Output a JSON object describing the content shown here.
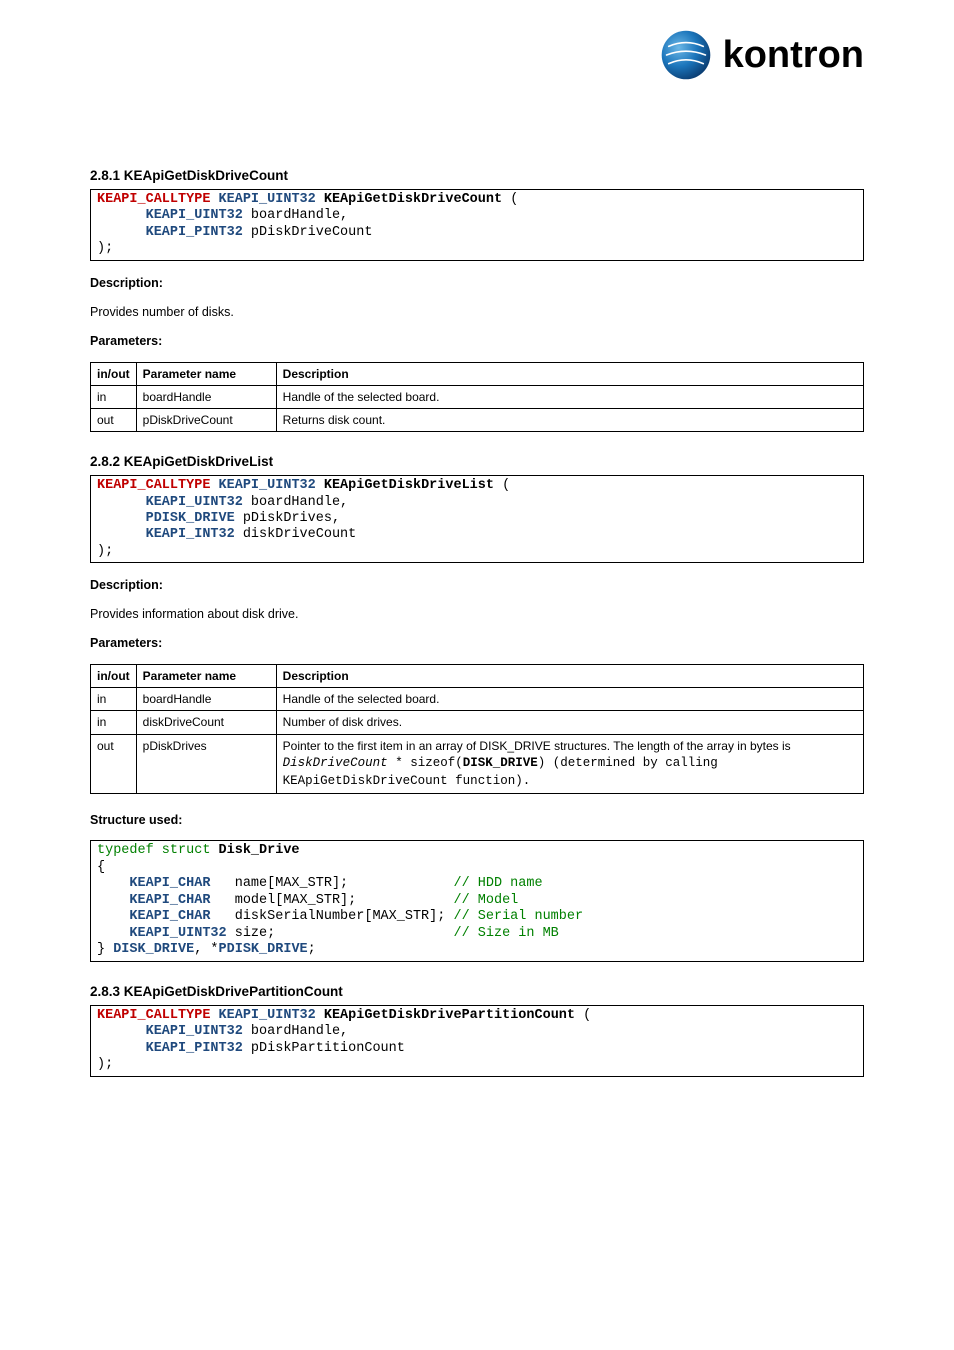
{
  "logo": {
    "brand": "kontron"
  },
  "fn1": {
    "heading": "2.8.1 KEApiGetDiskDriveCount",
    "sig": {
      "pre": "KEAPI_CALLTYPE",
      "ret": "KEAPI_UINT32",
      "name": "KEApiGetDiskDriveCount",
      "open": " (",
      "p1t": "KEAPI_UINT32",
      "p1n": " boardHandle,",
      "p2t": "KEAPI_PINT32",
      "p2n": " pDiskDriveCount",
      "close": ");"
    },
    "desc_label": "Description:",
    "desc": "Provides number of disks.",
    "params_label": "Parameters:",
    "th": {
      "a": "in/out",
      "b": "Parameter name",
      "c": "Description"
    },
    "rows": [
      {
        "a": "in",
        "b": "boardHandle",
        "c": "Handle of the selected board."
      },
      {
        "a": "out",
        "b": "pDiskDriveCount",
        "c": "Returns disk count."
      }
    ]
  },
  "fn2": {
    "heading": "2.8.2 KEApiGetDiskDriveList",
    "sig": {
      "pre": "KEAPI_CALLTYPE",
      "ret": "KEAPI_UINT32",
      "name": "KEApiGetDiskDriveList",
      "open": " (",
      "p1t": "KEAPI_UINT32",
      "p1n": " boardHandle,",
      "p2t": "PDISK_DRIVE",
      "p2n": " pDiskDrives,",
      "p3t": "KEAPI_INT32",
      "p3n": " diskDriveCount",
      "close": ");"
    },
    "desc_label": "Description:",
    "desc": "Provides information about disk drive.",
    "params_label": "Parameters:",
    "th": {
      "a": "in/out",
      "b": "Parameter name",
      "c": "Description"
    },
    "rows": [
      {
        "a": "in",
        "b": "boardHandle",
        "c": "Handle of the selected board."
      },
      {
        "a": "in",
        "b": "diskDriveCount",
        "c": "Number of disk drives."
      },
      {
        "a": "out",
        "b": "pDiskDrives",
        "c1": "Pointer to the first item in an array of DISK_DRIVE structures. The length of the array in bytes is ",
        "c_ital": "DiskDriveCount",
        "c2": " * sizeof(",
        "c_bold": "DISK_DRIVE",
        "c3": ") (determined by calling KEApiGetDiskDriveCount function)."
      }
    ],
    "struct_label": "Structure used:",
    "struct": {
      "l1a": "typedef struct",
      "l1b": " Disk_Drive",
      "l2": "{",
      "r1t": "KEAPI_CHAR",
      "r1n": "   name[MAX_STR];             ",
      "r1c": "// HDD name",
      "r2t": "KEAPI_CHAR",
      "r2n": "   model[MAX_STR];            ",
      "r2c": "// Model",
      "r3t": "KEAPI_CHAR",
      "r3n": "   diskSerialNumber[MAX_STR]; ",
      "r3c": "// Serial number",
      "r4t": "KEAPI_UINT32",
      "r4n": " size;                      ",
      "r4c": "// Size in MB",
      "l6a": "} ",
      "l6b": "DISK_DRIVE",
      "l6c": ", *",
      "l6d": "PDISK_DRIVE",
      "l6e": ";"
    }
  },
  "fn3": {
    "heading": "2.8.3 KEApiGetDiskDrivePartitionCount",
    "sig": {
      "pre": "KEAPI_CALLTYPE",
      "ret": "KEAPI_UINT32",
      "name": "KEApiGetDiskDrivePartitionCount",
      "open": " (",
      "p1t": "KEAPI_UINT32",
      "p1n": " boardHandle,",
      "p2t": "KEAPI_PINT32",
      "p2n": " pDiskPartitionCount",
      "close": ");"
    }
  }
}
